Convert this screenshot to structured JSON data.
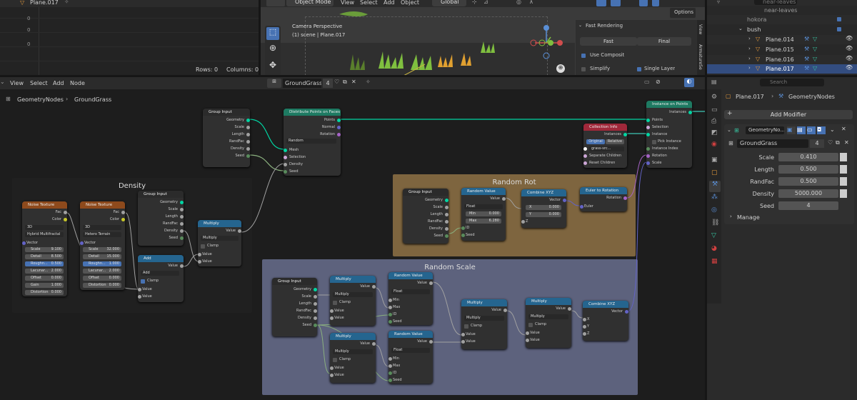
{
  "top": {
    "object_name": "Plane.017",
    "rows": "Rows: 0",
    "columns": "Columns: 0"
  },
  "viewport": {
    "mode": "Object Mode",
    "view": "View",
    "select": "Select",
    "add": "Add",
    "object": "Object",
    "orientation": "Global",
    "options": "Options",
    "camera": "Camera Perspective",
    "scene": "(1) scene | Plane.017"
  },
  "render_panel": {
    "title": "Fast Rendering",
    "fast": "Fast",
    "final": "Final",
    "use_composit": "Use Composit",
    "simplify": "Simplify",
    "single_layer": "Single Layer",
    "tab_view": "View",
    "tab_arm": "ArmatureSe"
  },
  "outliner": {
    "items": [
      {
        "label": "near-leaves"
      },
      {
        "label": "hokora"
      },
      {
        "label": "bush"
      },
      {
        "label": "Plane.014"
      },
      {
        "label": "Plane.015"
      },
      {
        "label": "Plane.016"
      },
      {
        "label": "Plane.017"
      }
    ],
    "search_placeholder": "Search"
  },
  "node_editor": {
    "menu_view": "View",
    "menu_select": "Select",
    "menu_add": "Add",
    "menu_node": "Node",
    "tree_name": "GroundGrass",
    "users": "4",
    "breadcrumb_1": "GeometryNodes",
    "breadcrumb_2": "GroundGrass"
  },
  "props": {
    "search_placeholder": "Search",
    "object": "Plane.017",
    "modifier": "GeometryNodes",
    "add_modifier": "Add Modifier",
    "mod_name": "GeometryNo...",
    "group": "GroundGrass",
    "users": "4",
    "fields": [
      {
        "label": "Scale",
        "value": "0.410"
      },
      {
        "label": "Length",
        "value": "0.500"
      },
      {
        "label": "RandFac",
        "value": "0.500"
      },
      {
        "label": "Density",
        "value": "5000.000"
      },
      {
        "label": "Seed",
        "value": "4"
      }
    ],
    "manage": "Manage"
  },
  "frames": {
    "density": "Density",
    "random_rot": "Random Rot",
    "random_scale": "Random Scale"
  },
  "nodes": {
    "group_input": "Group Input",
    "gi_outputs": [
      "Geometry",
      "Scale",
      "Length",
      "RandFac",
      "Density",
      "Seed"
    ],
    "distribute": "Distribute Points on Faces",
    "dist_outputs": [
      "Points",
      "Normal",
      "Rotation"
    ],
    "dist_mode": "Random",
    "dist_inputs": [
      "Mesh",
      "Selection",
      "Density",
      "Seed"
    ],
    "instance": "Instance on Points",
    "inst_out": "Instances",
    "inst_inputs": [
      "Points",
      "Selection",
      "Instance",
      "Pick Instance",
      "Instance Index",
      "Rotation",
      "Scale"
    ],
    "collection": "Collection Info",
    "coll_out": "Instances",
    "coll_original": "Original",
    "coll_relative": "Relative",
    "coll_value": "grass-src...",
    "coll_sep": "Separate Children",
    "coll_reset": "Reset Children",
    "noise1": "Noise Texture",
    "noise2": "Noise Texture",
    "noise_outputs": [
      "Fac",
      "Color"
    ],
    "noise_dim": "3D",
    "noise1_type": "Hybrid Multifractal",
    "noise2_type": "Hetero Terrain",
    "vector": "Vector",
    "noise1_fields": [
      {
        "l": "Scale",
        "v": "9.100"
      },
      {
        "l": "Detail",
        "v": "8.500"
      },
      {
        "l": "Roughn...",
        "v": "0.500"
      },
      {
        "l": "Lacunar...",
        "v": "2.000"
      },
      {
        "l": "Offset",
        "v": "0.000"
      },
      {
        "l": "Gain",
        "v": "1.000"
      },
      {
        "l": "Distortion",
        "v": "0.000"
      }
    ],
    "noise2_fields": [
      {
        "l": "Scale",
        "v": "32.000"
      },
      {
        "l": "Detail",
        "v": "15.000"
      },
      {
        "l": "Roughn...",
        "v": "1.000"
      },
      {
        "l": "Lacunar...",
        "v": "2.000"
      },
      {
        "l": "Offset",
        "v": "0.000"
      },
      {
        "l": "Distortion",
        "v": "0.000"
      }
    ],
    "add": "Add",
    "value": "Value",
    "clamp": "Clamp",
    "multiply": "Multiply",
    "random_value": "Random Value",
    "float": "Float",
    "min": "Min",
    "max": "Max",
    "min_v": "0.000",
    "max_v": "6.280",
    "id": "ID",
    "seed": "Seed",
    "combine": "Combine XYZ",
    "x": "X",
    "y": "Y",
    "z": "Z",
    "x_v": "0.000",
    "y_v": "0.000",
    "euler": "Euler to Rotation",
    "rotation": "Rotation",
    "euler_in": "Euler"
  }
}
